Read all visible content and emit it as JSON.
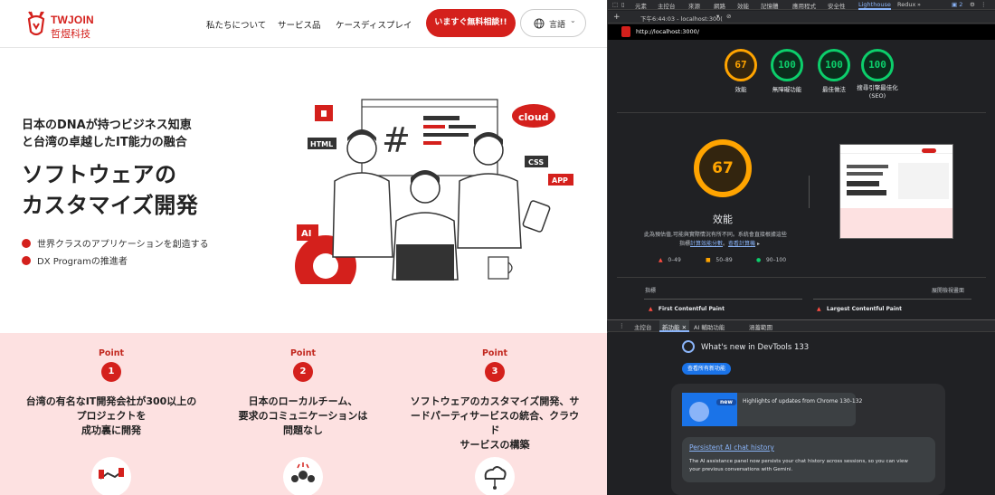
{
  "site": {
    "logo": {
      "name": "TWJOIN",
      "sub": "哲煜科技"
    },
    "nav": [
      "私たちについて",
      "サービス品",
      "ケースディスプレイ"
    ],
    "cta_label": "いますぐ無料相談!!",
    "language_label": "言語",
    "hero": {
      "subtitle_line1": "日本のDNAが持つビジネス知恵",
      "subtitle_line2": "と台湾の卓越したIT能力の融合",
      "title_line1": "ソフトウェアの",
      "title_line2": "カスタマイズ開発",
      "bullets": [
        "世界クラスのアプリケーションを創造する",
        "DX Programの推進者"
      ]
    },
    "illustration_labels": {
      "html": "HTML",
      "css": "CSS",
      "app": "APP",
      "ai": "AI",
      "cloud": "cloud"
    },
    "points": [
      {
        "label": "Point",
        "num": "1",
        "text": "台湾の有名なIT開発会社が300以上の\nプロジェクトを\n成功裏に開発"
      },
      {
        "label": "Point",
        "num": "2",
        "text": "日本のローカルチーム、\n要求のコミュニケーションは\n問題なし"
      },
      {
        "label": "Point",
        "num": "3",
        "text": "ソフトウェアのカスタマイズ開発、サ\nードパーティサービスの統合、クラウ\nド\nサービスの構築"
      }
    ],
    "colors": {
      "brand": "#d4201c",
      "points_bg": "#fde1e1"
    }
  },
  "devtools": {
    "top_tabs": [
      "元素",
      "主控台",
      "來源",
      "網路",
      "效能",
      "記憶體",
      "應用程式",
      "安全性",
      "Lighthouse",
      "Redux"
    ],
    "active_tab": "Lighthouse",
    "badge": "2",
    "toolbar_time": "下午6:44:03 - localhost:300(",
    "url": "http://localhost:3000/",
    "scores": [
      {
        "value": "67",
        "label": "效能",
        "color": "#ffa400"
      },
      {
        "value": "100",
        "label": "無障礙功能",
        "color": "#0cce6b"
      },
      {
        "value": "100",
        "label": "最佳做法",
        "color": "#0cce6b"
      },
      {
        "value": "100",
        "label": "搜尋引擎最佳化\n(SEO)",
        "color": "#0cce6b"
      }
    ],
    "main_score": {
      "value": "67",
      "label": "效能"
    },
    "note_line1": "此為預估值,可能與實際情況有所不同。系統會直接根據這些",
    "note_line2": "指標",
    "note_link1": "計算效能分數",
    "note_sep": "。",
    "note_link2": "查看計算機",
    "legend": [
      {
        "range": "0–49",
        "color": "#ff4e42"
      },
      {
        "range": "50–89",
        "color": "#ffa400"
      },
      {
        "range": "90–100",
        "color": "#0cce6b"
      }
    ],
    "metrics_label": "指標",
    "expand_label": "展開檢視畫面",
    "metric1": "First Contentful Paint",
    "metric2": "Largest Contentful Paint",
    "drawer_tabs": [
      "主控台",
      "新功能",
      "AI 輔助功能",
      "涵蓋範圍"
    ],
    "drawer_active": "新功能",
    "whats_new_title": "What's new in DevTools 133",
    "see_all_label": "查看所有新功能",
    "new_badge": "new",
    "highlights": "Highlights of updates from Chrome 130-132",
    "feature_title": "Persistent AI chat history",
    "feature_desc1": "The AI assistance panel now persists your chat history across sessions, so you can view",
    "feature_desc2": "your previous conversations with Gemini."
  }
}
